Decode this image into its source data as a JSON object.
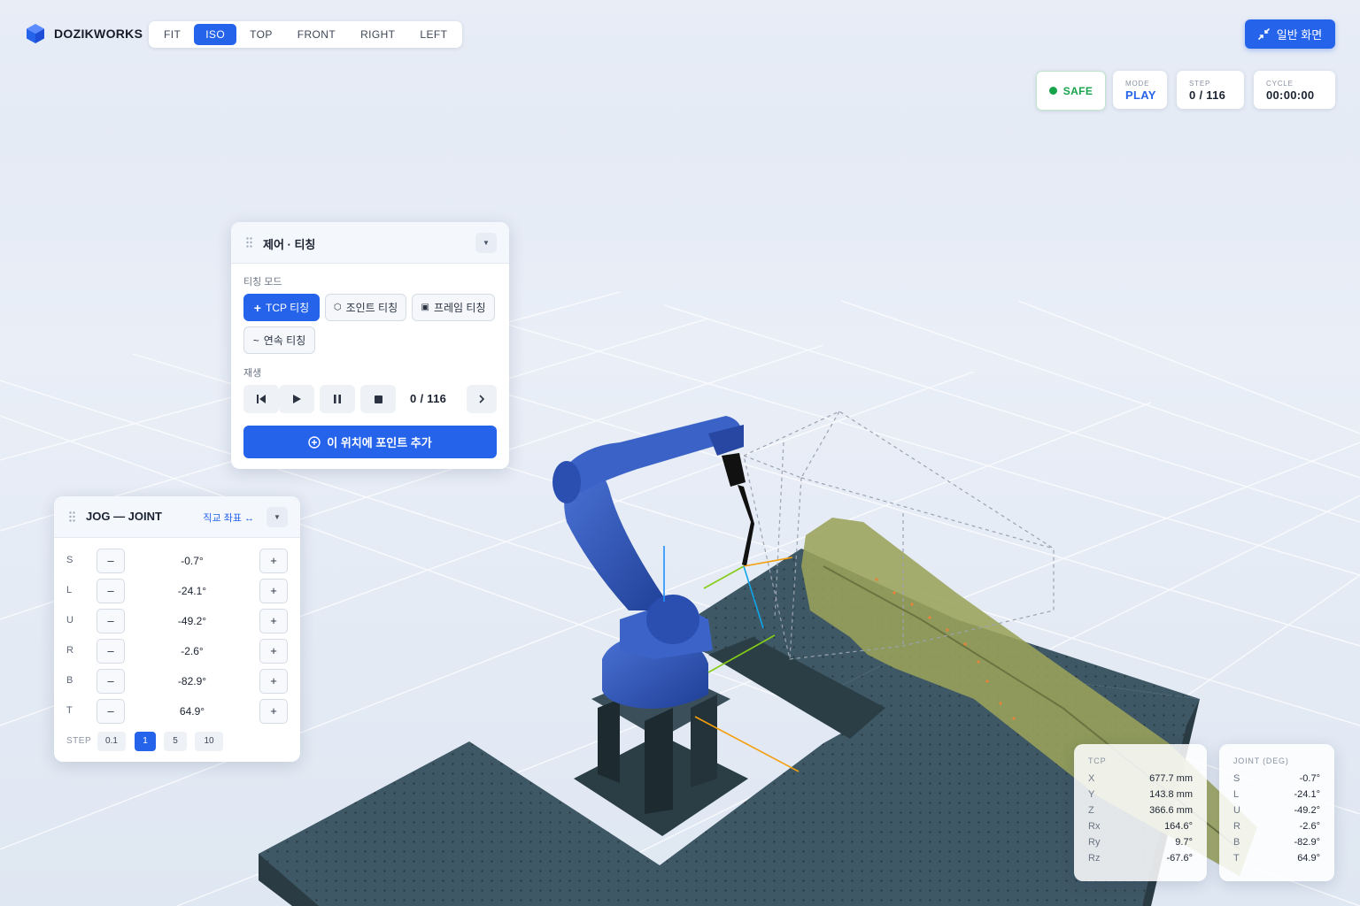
{
  "brand": {
    "name": "DOZIKWORKS"
  },
  "view_buttons": [
    {
      "label": "FIT",
      "active": false
    },
    {
      "label": "ISO",
      "active": true
    },
    {
      "label": "TOP",
      "active": false
    },
    {
      "label": "FRONT",
      "active": false
    },
    {
      "label": "RIGHT",
      "active": false
    },
    {
      "label": "LEFT",
      "active": false
    }
  ],
  "normal_view_button": {
    "label": "일반 화면",
    "icon": "collapse-arrows-icon"
  },
  "status": {
    "safe": {
      "label": "SAFE",
      "color": "#16a34a"
    },
    "mode": {
      "label": "MODE",
      "value": "PLAY"
    },
    "step": {
      "label": "STEP",
      "value": "0 / 116"
    },
    "cycle": {
      "label": "CYCLE",
      "value": "00:00:00"
    }
  },
  "control_panel": {
    "title": "제어 · 티칭",
    "teach_mode_label": "티칭 모드",
    "modes": [
      {
        "icon": "+",
        "label": "TCP 티칭",
        "active": true
      },
      {
        "icon": "⬡",
        "label": "조인트 티칭",
        "active": false
      },
      {
        "icon": "▣",
        "label": "프레임 티칭",
        "active": false
      },
      {
        "icon": "~",
        "label": "연속 티칭",
        "active": false
      }
    ],
    "playback_label": "재생",
    "playback_count": "0 / 116",
    "add_point_label": "이 위치에 포인트 추가"
  },
  "jog_panel": {
    "title": "JOG — JOINT",
    "coord_toggle": "직교 좌표 ↔",
    "minus": "–",
    "plus": "+",
    "joints": [
      {
        "axis": "S",
        "value": "-0.7°"
      },
      {
        "axis": "L",
        "value": "-24.1°"
      },
      {
        "axis": "U",
        "value": "-49.2°"
      },
      {
        "axis": "R",
        "value": "-2.6°"
      },
      {
        "axis": "B",
        "value": "-82.9°"
      },
      {
        "axis": "T",
        "value": "64.9°"
      }
    ],
    "step_label": "STEP",
    "steps": [
      {
        "label": "0.1",
        "active": false
      },
      {
        "label": "1",
        "active": true
      },
      {
        "label": "5",
        "active": false
      },
      {
        "label": "10",
        "active": false
      }
    ]
  },
  "tcp_readout": {
    "title": "TCP",
    "rows": [
      {
        "key": "X",
        "value": "677.7 mm"
      },
      {
        "key": "Y",
        "value": "143.8 mm"
      },
      {
        "key": "Z",
        "value": "366.6 mm"
      },
      {
        "key": "Rx",
        "value": "164.6°"
      },
      {
        "key": "Ry",
        "value": "9.7°"
      },
      {
        "key": "Rz",
        "value": "-67.6°"
      }
    ]
  },
  "joint_readout": {
    "title": "JOINT (DEG)",
    "rows": [
      {
        "key": "S",
        "value": "-0.7°"
      },
      {
        "key": "L",
        "value": "-24.1°"
      },
      {
        "key": "U",
        "value": "-49.2°"
      },
      {
        "key": "R",
        "value": "-2.6°"
      },
      {
        "key": "B",
        "value": "-82.9°"
      },
      {
        "key": "T",
        "value": "64.9°"
      }
    ]
  },
  "colors": {
    "accent": "#2563eb",
    "table": "#3d5563",
    "robot": "#2f55b8",
    "workpiece": "#9aa25a",
    "safe": "#16a34a"
  }
}
